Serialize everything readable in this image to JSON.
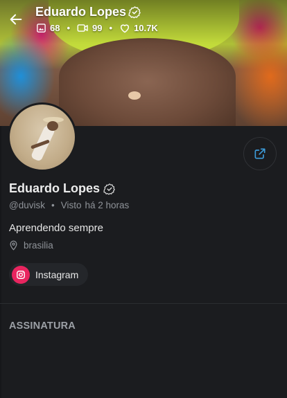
{
  "header": {
    "name": "Eduardo Lopes",
    "stats": {
      "photos": "68",
      "videos": "99",
      "likes": "10.7K"
    }
  },
  "profile": {
    "name": "Eduardo Lopes",
    "handle": "@duvisk",
    "separator": "•",
    "seen_label": "Visto",
    "seen_time": "há 2 horas",
    "bio": "Aprendendo sempre",
    "location": "brasilia"
  },
  "links": {
    "instagram_label": "Instagram"
  },
  "sections": {
    "subscription_title": "ASSINATURA"
  },
  "colors": {
    "background": "#1b1c1f",
    "accent": "#3d9bd9",
    "instagram": "#e8255f"
  }
}
